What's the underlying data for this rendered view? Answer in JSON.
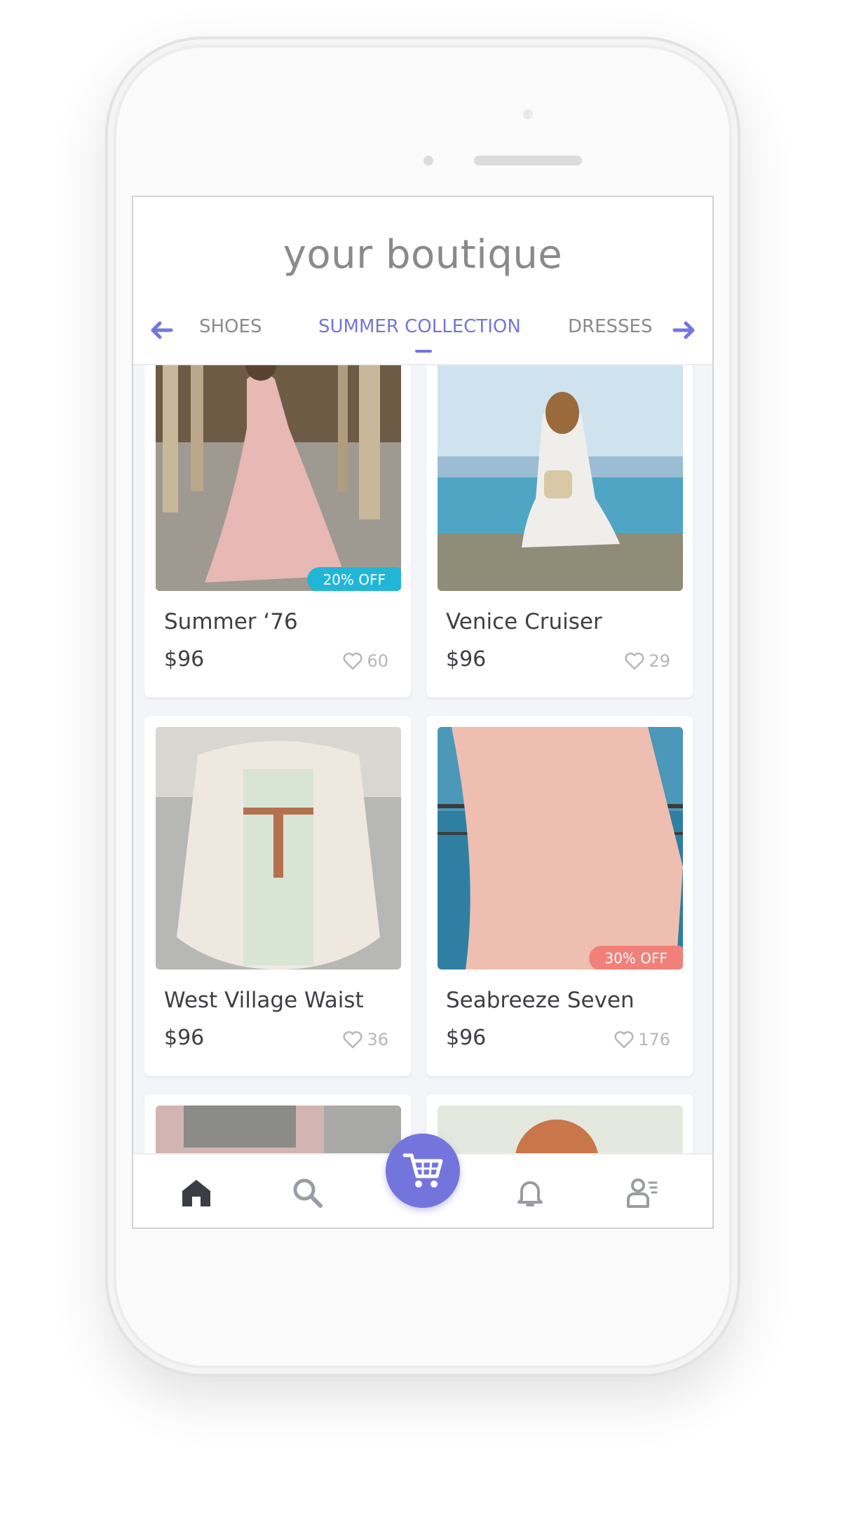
{
  "app": {
    "title": "your boutique"
  },
  "tabs": [
    {
      "label": "SHOES"
    },
    {
      "label": "SUMMER COLLECTION"
    },
    {
      "label": "DRESSES"
    }
  ],
  "products": [
    {
      "name": "Summer ‘76",
      "price": "$96",
      "likes": "60",
      "badge": "20% OFF"
    },
    {
      "name": "Venice Cruiser",
      "price": "$96",
      "likes": "29",
      "badge": ""
    },
    {
      "name": "West Village Waist",
      "price": "$96",
      "likes": "36",
      "badge": ""
    },
    {
      "name": "Seabreeze Seven",
      "price": "$96",
      "likes": "176",
      "badge": "30% OFF"
    }
  ],
  "colors": {
    "accent": "#7475dc",
    "badge_teal": "#22b6d6",
    "badge_coral": "#f2807a"
  },
  "nav": [
    "home-icon",
    "search-icon",
    "cart-icon",
    "bell-icon",
    "profile-icon"
  ]
}
